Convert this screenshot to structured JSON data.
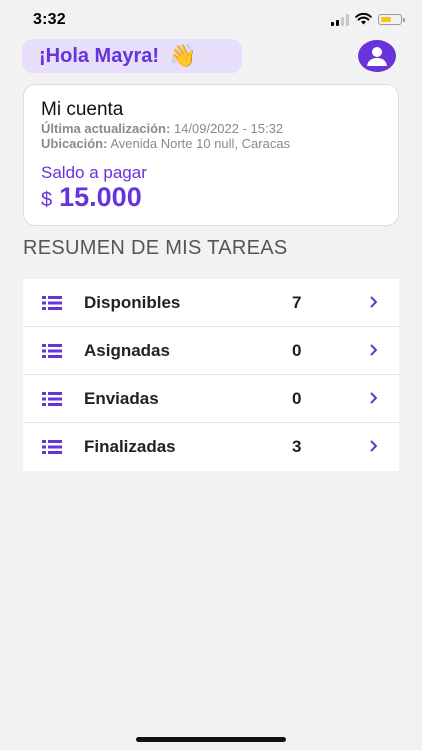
{
  "status_bar": {
    "time": "3:32",
    "battery_color": "#f5c518",
    "icons": [
      "signal-icon",
      "wifi-icon",
      "battery-icon"
    ]
  },
  "header": {
    "greeting": "¡Hola Mayra!",
    "wave_emoji": "👋",
    "avatar_icon": "user-icon"
  },
  "account": {
    "title": "Mi cuenta",
    "last_update_label": "Última actualización:",
    "last_update_value": "14/09/2022 - 15:32",
    "location_label": "Ubicación:",
    "location_value": "Avenida Norte 10 null, Caracas",
    "balance_label": "Saldo a pagar",
    "currency": "$",
    "balance_amount": "15.000"
  },
  "tasks": {
    "section_title": "RESUMEN DE MIS TAREAS",
    "row_icon": "list-icon",
    "chevron_icon": "chevron-right-icon",
    "items": [
      {
        "label": "Disponibles",
        "count": "7"
      },
      {
        "label": "Asignadas",
        "count": "0"
      },
      {
        "label": "Enviadas",
        "count": "0"
      },
      {
        "label": "Finalizadas",
        "count": "3"
      }
    ]
  },
  "colors": {
    "accent": "#6633dd",
    "greeting_bg": "#e7defa",
    "background": "#f2f2f2"
  }
}
